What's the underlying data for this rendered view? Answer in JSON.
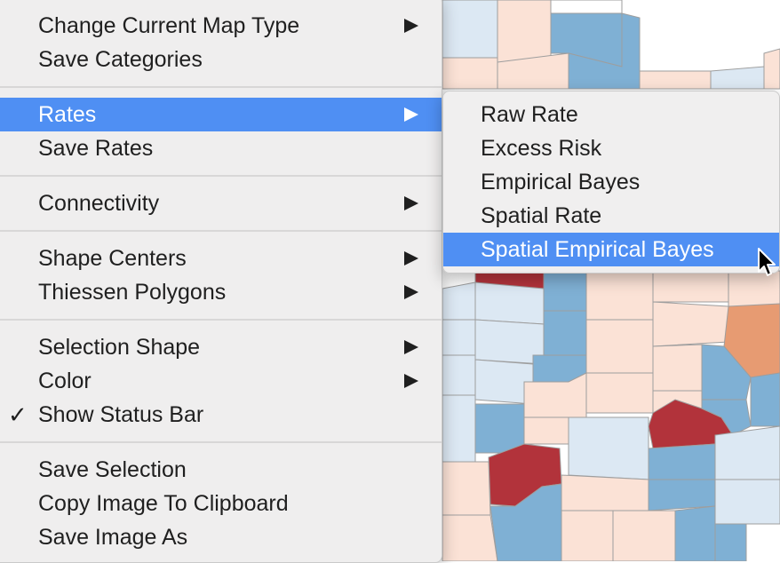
{
  "main_menu": {
    "items": [
      {
        "label": "Change Current Map Type",
        "submenu": true
      },
      {
        "label": "Save Categories",
        "submenu": false
      },
      {
        "label": "Rates",
        "submenu": true,
        "active": true
      },
      {
        "label": "Save Rates",
        "submenu": false
      },
      {
        "label": "Connectivity",
        "submenu": true
      },
      {
        "label": "Shape Centers",
        "submenu": true
      },
      {
        "label": "Thiessen Polygons",
        "submenu": true
      },
      {
        "label": "Selection Shape",
        "submenu": true
      },
      {
        "label": "Color",
        "submenu": true
      },
      {
        "label": "Show Status Bar",
        "submenu": false,
        "checked": true,
        "check_glyph": "✓"
      },
      {
        "label": "Save Selection",
        "submenu": false
      },
      {
        "label": "Copy Image To Clipboard",
        "submenu": false
      },
      {
        "label": "Save Image As",
        "submenu": false
      }
    ]
  },
  "rates_submenu": {
    "items": [
      {
        "label": "Raw Rate"
      },
      {
        "label": "Excess Risk"
      },
      {
        "label": "Empirical Bayes"
      },
      {
        "label": "Spatial Rate"
      },
      {
        "label": "Spatial Empirical Bayes",
        "active": true
      }
    ]
  },
  "colors": {
    "highlight": "#4f8ff3",
    "map_dark_red": "#b2333b",
    "map_orange": "#e79b72",
    "map_light_peach": "#fbe2d6",
    "map_light_blue": "#dce8f3",
    "map_mid_blue": "#7fb0d4"
  },
  "icons": {
    "submenu_arrow": "right-triangle-icon",
    "cursor": "mouse-pointer-icon"
  }
}
